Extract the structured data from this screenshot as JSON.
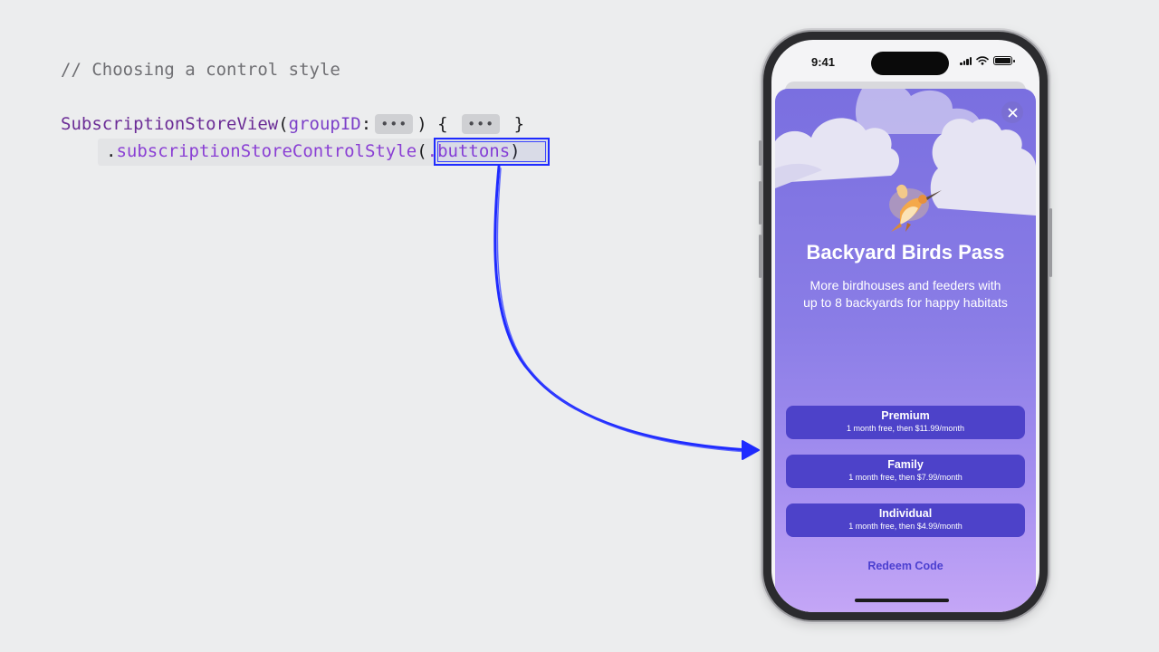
{
  "slide": {
    "comment": "// Choosing a control style",
    "code": {
      "type_name": "SubscriptionStoreView",
      "open_paren": "(",
      "label": "groupID",
      "colon": ":",
      "placeholder1": "•••",
      "mid": ") {",
      "placeholder2": "•••",
      "close_brace": "}",
      "dot": ".",
      "modifier": "subscriptionStoreControlStyle",
      "arg_open": "(",
      "argument": ".buttons",
      "arg_close": ")"
    }
  },
  "phone": {
    "status_bar": {
      "time": "9:41"
    },
    "store": {
      "title": "Backyard Birds Pass",
      "subtitle": "More birdhouses and feeders with up to 8 backyards for happy habitats",
      "plans": [
        {
          "name": "Premium",
          "price": "1 month free, then $11.99/month"
        },
        {
          "name": "Family",
          "price": "1 month free, then $7.99/month"
        },
        {
          "name": "Individual",
          "price": "1 month free, then $4.99/month"
        }
      ],
      "redeem_label": "Redeem Code",
      "close_icon": "close-icon"
    }
  },
  "colors": {
    "background": "#ecedee",
    "annotation": "#1f2bff",
    "sheet_top": "#7a6fe0",
    "sheet_bottom": "#c4a6f6",
    "plan_button": "#4d42c9",
    "redeem_text": "#4b3fd0"
  }
}
